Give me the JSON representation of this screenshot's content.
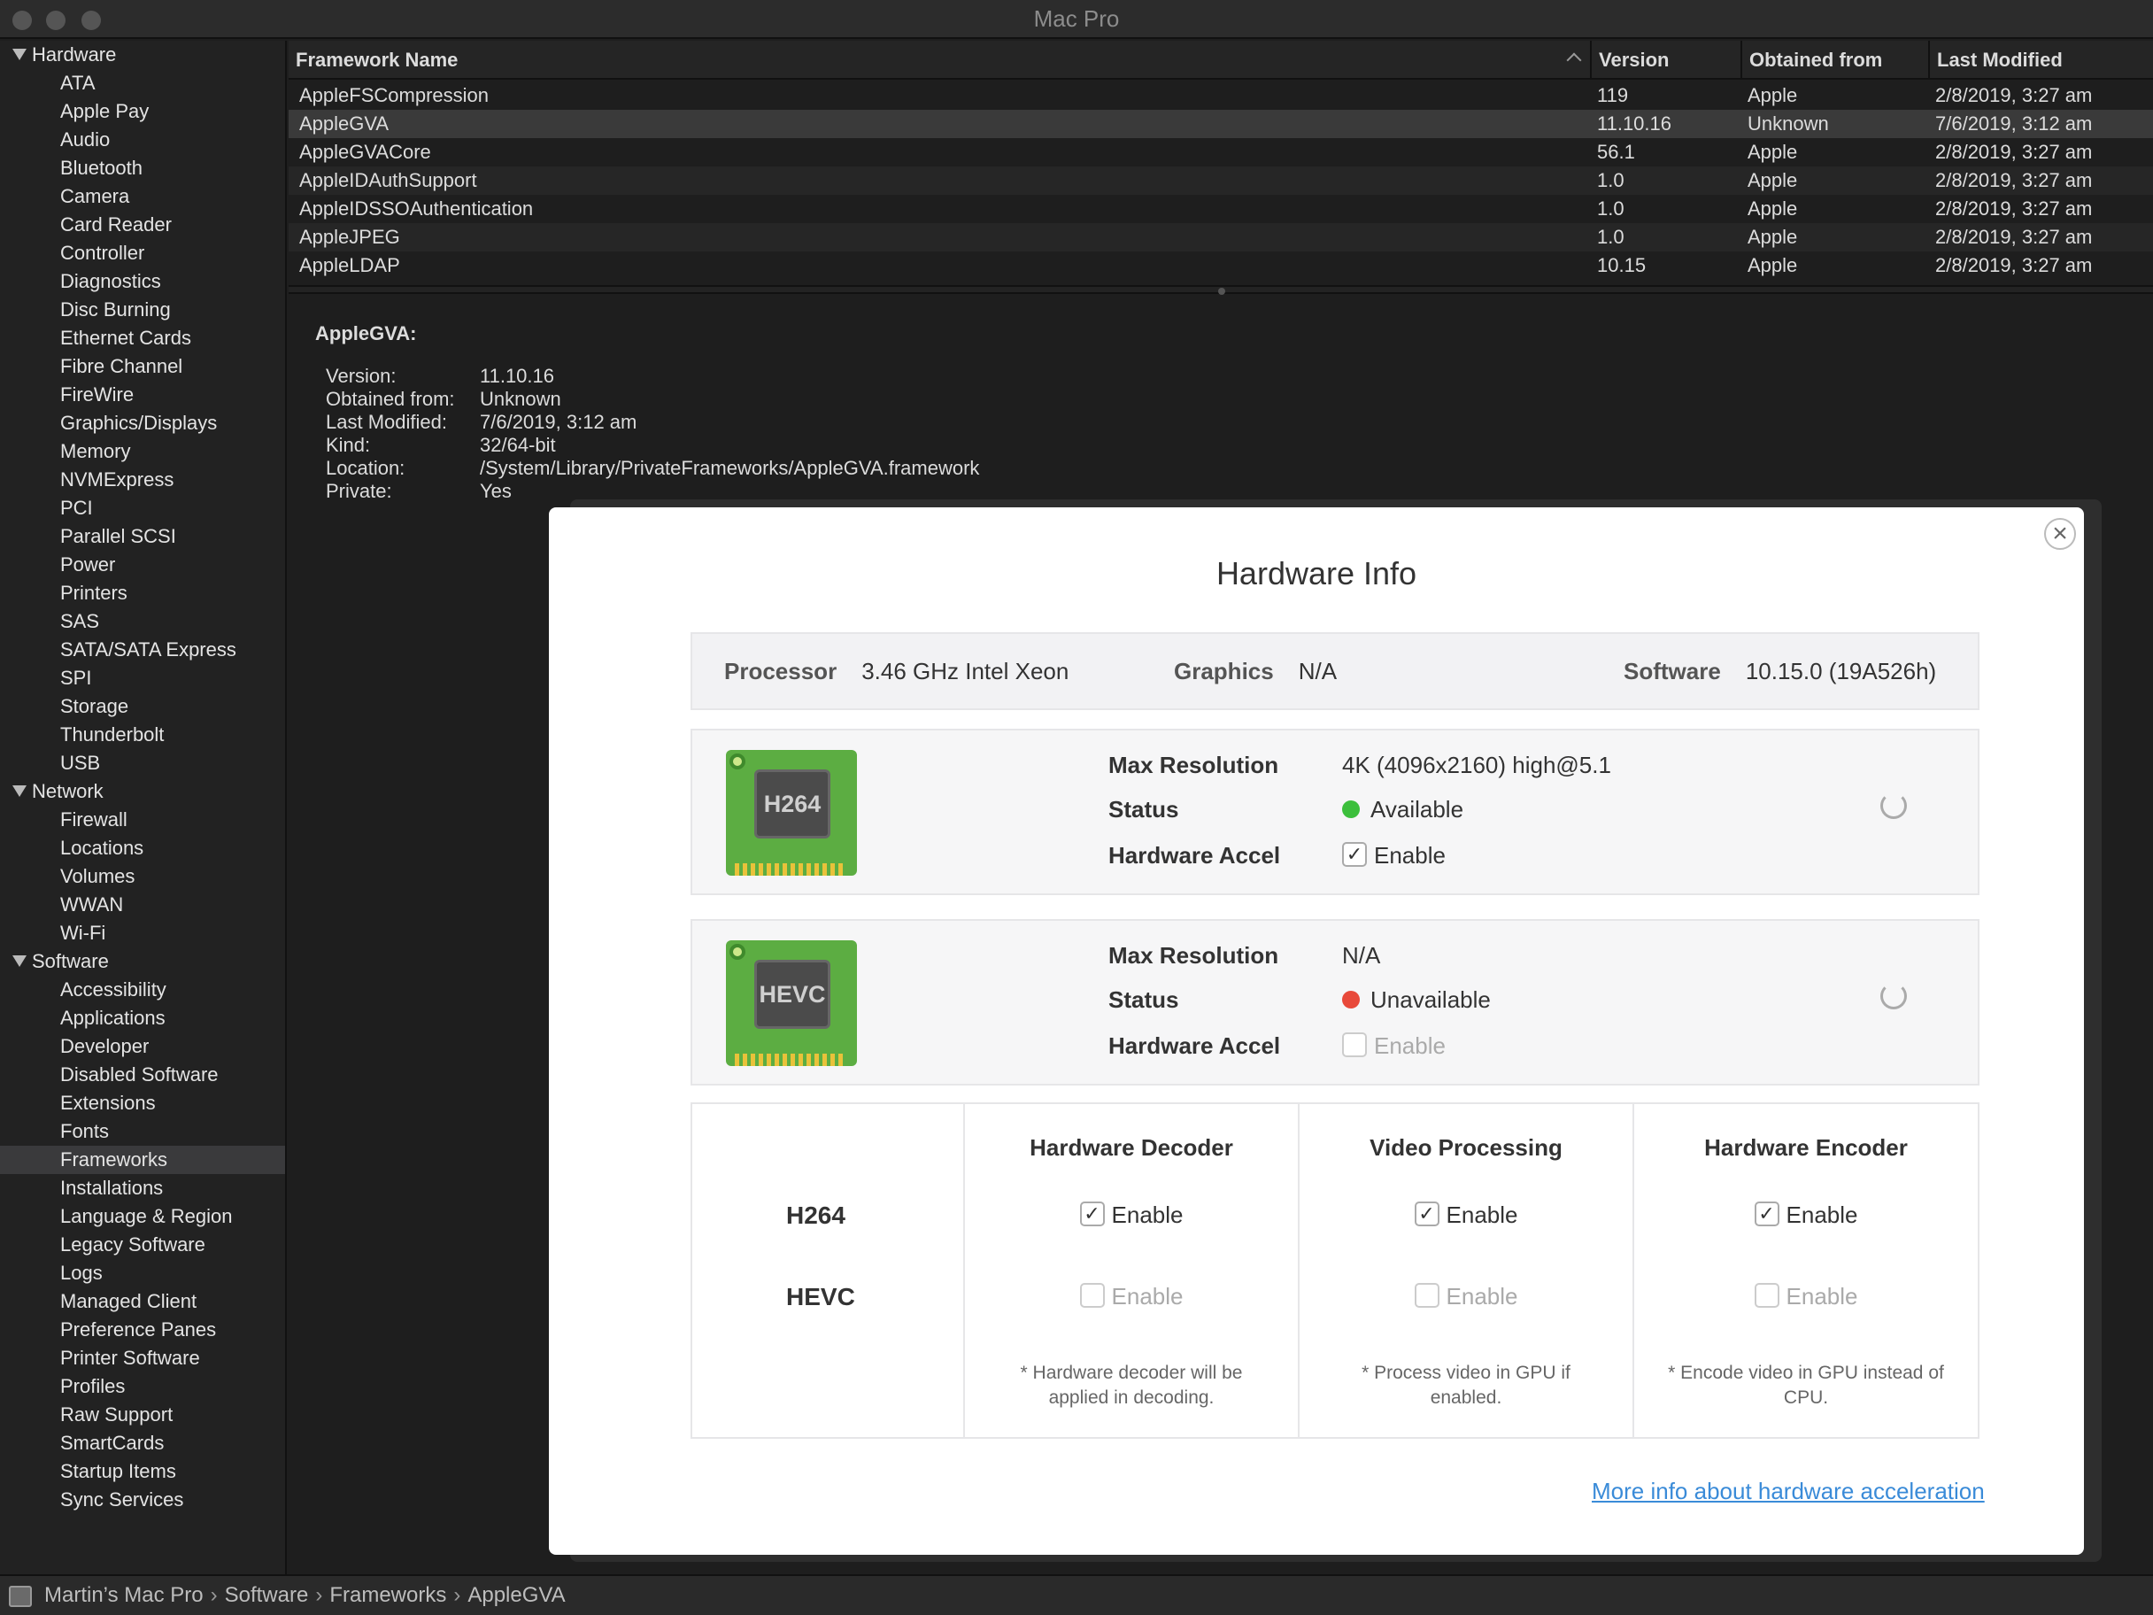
{
  "window": {
    "title": "Mac Pro"
  },
  "sidebar": {
    "groups": [
      {
        "label": "Hardware",
        "items": [
          "ATA",
          "Apple Pay",
          "Audio",
          "Bluetooth",
          "Camera",
          "Card Reader",
          "Controller",
          "Diagnostics",
          "Disc Burning",
          "Ethernet Cards",
          "Fibre Channel",
          "FireWire",
          "Graphics/Displays",
          "Memory",
          "NVMExpress",
          "PCI",
          "Parallel SCSI",
          "Power",
          "Printers",
          "SAS",
          "SATA/SATA Express",
          "SPI",
          "Storage",
          "Thunderbolt",
          "USB"
        ]
      },
      {
        "label": "Network",
        "items": [
          "Firewall",
          "Locations",
          "Volumes",
          "WWAN",
          "Wi-Fi"
        ]
      },
      {
        "label": "Software",
        "items": [
          "Accessibility",
          "Applications",
          "Developer",
          "Disabled Software",
          "Extensions",
          "Fonts",
          "Frameworks",
          "Installations",
          "Language & Region",
          "Legacy Software",
          "Logs",
          "Managed Client",
          "Preference Panes",
          "Printer Software",
          "Profiles",
          "Raw Support",
          "SmartCards",
          "Startup Items",
          "Sync Services"
        ]
      }
    ],
    "selected": "Frameworks"
  },
  "table": {
    "columns": [
      "Framework Name",
      "Version",
      "Obtained from",
      "Last Modified"
    ],
    "rows": [
      [
        "AppleFSCompression",
        "119",
        "Apple",
        "2/8/2019, 3:27 am"
      ],
      [
        "AppleGVA",
        "11.10.16",
        "Unknown",
        "7/6/2019, 3:12 am"
      ],
      [
        "AppleGVACore",
        "56.1",
        "Apple",
        "2/8/2019, 3:27 am"
      ],
      [
        "AppleIDAuthSupport",
        "1.0",
        "Apple",
        "2/8/2019, 3:27 am"
      ],
      [
        "AppleIDSSOAuthentication",
        "1.0",
        "Apple",
        "2/8/2019, 3:27 am"
      ],
      [
        "AppleJPEG",
        "1.0",
        "Apple",
        "2/8/2019, 3:27 am"
      ],
      [
        "AppleLDAP",
        "10.15",
        "Apple",
        "2/8/2019, 3:27 am"
      ]
    ],
    "selected_row": "AppleGVA"
  },
  "detail": {
    "title": "AppleGVA:",
    "fields": [
      {
        "label": "Version:",
        "value": "11.10.16"
      },
      {
        "label": "Obtained from:",
        "value": "Unknown"
      },
      {
        "label": "Last Modified:",
        "value": "7/6/2019, 3:12 am"
      },
      {
        "label": "Kind:",
        "value": "32/64-bit"
      },
      {
        "label": "Location:",
        "value": "/System/Library/PrivateFrameworks/AppleGVA.framework"
      },
      {
        "label": "Private:",
        "value": "Yes"
      }
    ]
  },
  "statusbar": {
    "crumbs": [
      "Martin’s Mac Pro",
      "Software",
      "Frameworks",
      "AppleGVA"
    ],
    "separator": "›"
  },
  "modal": {
    "title": "Hardware Info",
    "close": "×",
    "specs": {
      "processor_label": "Processor",
      "processor_value": "3.46 GHz Intel Xeon",
      "graphics_label": "Graphics",
      "graphics_value": "N/A",
      "software_label": "Software",
      "software_value": "10.15.0 (19A526h)"
    },
    "codecs": [
      {
        "chip": "H264",
        "max_res_label": "Max Resolution",
        "max_res": "4K (4096x2160) high@5.1",
        "status_label": "Status",
        "status": "Available",
        "status_color": "#3cbf3c",
        "accel_label": "Hardware Accel",
        "accel": "Enable",
        "accel_checked": true
      },
      {
        "chip": "HEVC",
        "max_res_label": "Max Resolution",
        "max_res": "N/A",
        "status_label": "Status",
        "status": "Unavailable",
        "status_color": "#e8493a",
        "accel_label": "Hardware Accel",
        "accel": "Enable",
        "accel_checked": false
      }
    ],
    "matrix": {
      "rows": [
        "H264",
        "HEVC"
      ],
      "columns": [
        {
          "header": "Hardware Decoder",
          "h264": "Enable",
          "hevc": "Enable",
          "note": "* Hardware decoder will be applied in decoding."
        },
        {
          "header": "Video Processing",
          "h264": "Enable",
          "hevc": "Enable",
          "note": "* Process video in GPU if enabled."
        },
        {
          "header": "Hardware Encoder",
          "h264": "Enable",
          "hevc": "Enable",
          "note": "* Encode video in GPU instead of CPU."
        }
      ]
    },
    "link": "More info about hardware acceleration"
  }
}
